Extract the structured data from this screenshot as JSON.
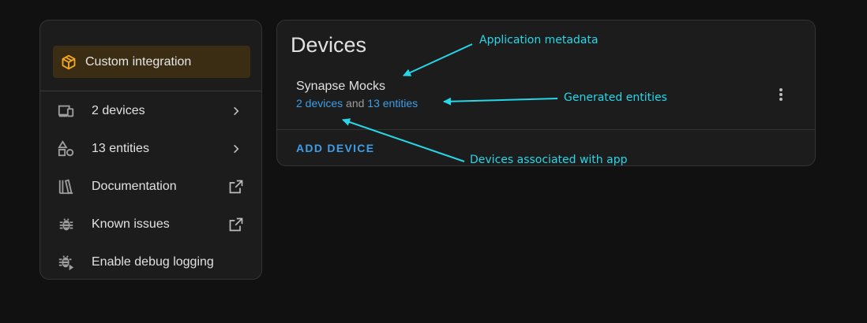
{
  "sidebar": {
    "badge_label": "Custom integration",
    "items": [
      {
        "label": "2 devices",
        "icon": "devices-icon",
        "trail": "chevron-right-icon"
      },
      {
        "label": "13 entities",
        "icon": "shapes-icon",
        "trail": "chevron-right-icon"
      },
      {
        "label": "Documentation",
        "icon": "book-icon",
        "trail": "open-in-new-icon"
      },
      {
        "label": "Known issues",
        "icon": "bug-icon",
        "trail": "open-in-new-icon"
      },
      {
        "label": "Enable debug logging",
        "icon": "bug-play-icon",
        "trail": ""
      }
    ]
  },
  "devices": {
    "title": "Devices",
    "entry": {
      "name": "Synapse Mocks",
      "devices_link": "2 devices",
      "and_text": "and",
      "entities_link": "13 entities"
    },
    "add_label": "ADD DEVICE"
  },
  "annotations": {
    "app_metadata": "Application metadata",
    "generated_entities": "Generated entities",
    "devices_associated": "Devices associated with app"
  },
  "colors": {
    "accent": "#3d9ee8",
    "annotation": "#25d7e8",
    "badge_icon": "#f5a623"
  }
}
